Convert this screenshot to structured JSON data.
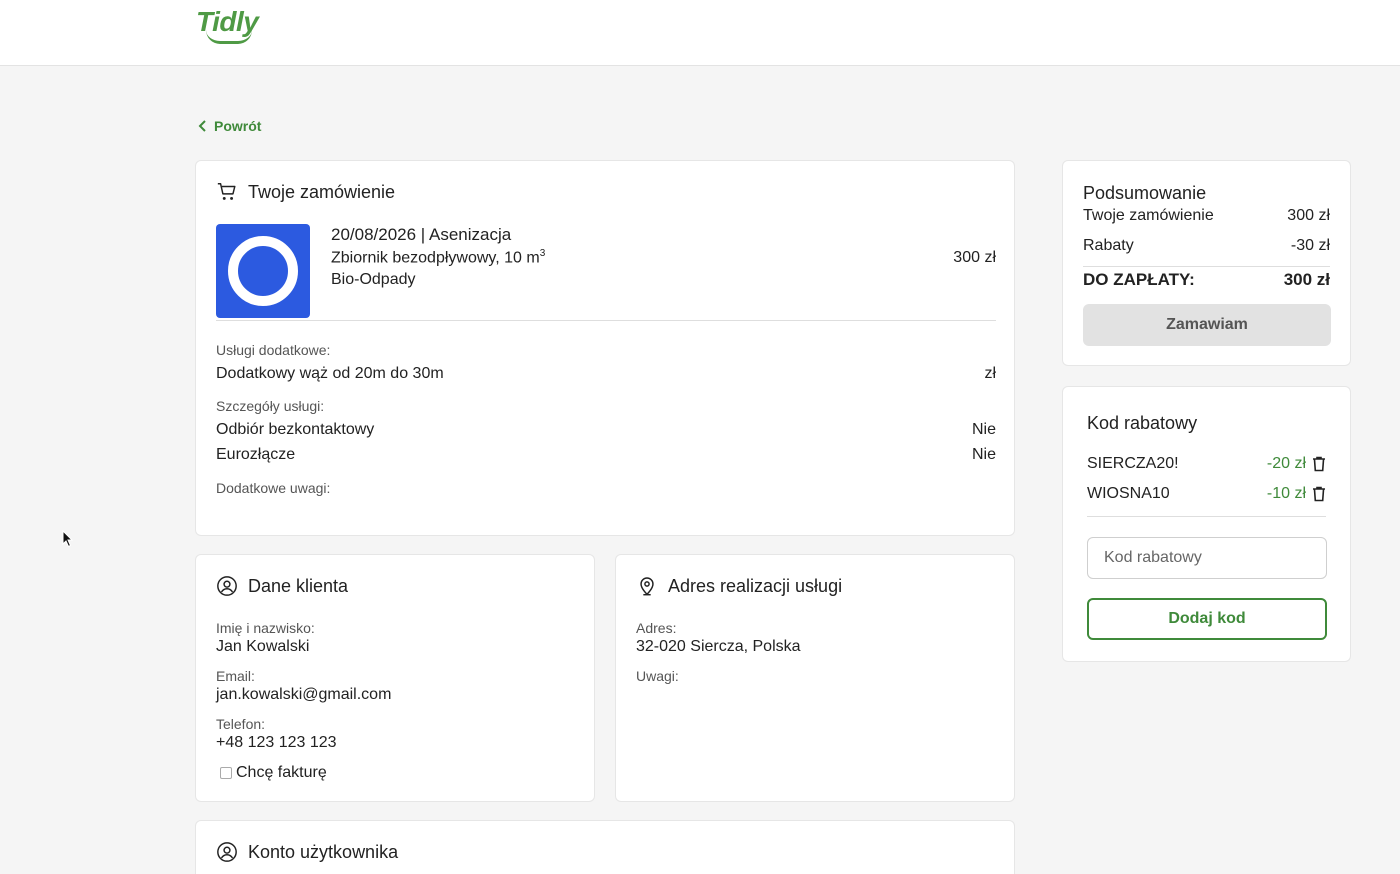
{
  "header": {
    "logo": "Tidly"
  },
  "nav": {
    "back_label": "Powrót"
  },
  "order": {
    "title": "Twoje zamówienie",
    "item": {
      "date_service": "20/08/2026 | Asenizacja",
      "tank": "Zbiornik bezodpływowy, 10 m",
      "tank_sup": "3",
      "category": "Bio-Odpady",
      "price": "300 zł"
    },
    "extra_services_label": "Usługi dodatkowe:",
    "extra_services": [
      {
        "name": "Dodatkowy wąż od 20m do 30m",
        "price": "zł"
      }
    ],
    "details_label": "Szczegóły usługi:",
    "details": [
      {
        "name": "Odbiór bezkontaktowy",
        "value": "Nie"
      },
      {
        "name": "Eurozłącze",
        "value": "Nie"
      }
    ],
    "notes_label": "Dodatkowe uwagi:"
  },
  "client": {
    "title": "Dane klienta",
    "name_label": "Imię i nazwisko:",
    "name": "Jan Kowalski",
    "email_label": "Email:",
    "email": "jan.kowalski@gmail.com",
    "phone_label": "Telefon:",
    "phone": "+48 123 123 123",
    "invoice_label": "Chcę fakturę"
  },
  "address": {
    "title": "Adres realizacji usługi",
    "address_label": "Adres:",
    "address": "32-020 Siercza, Polska",
    "notes_label": "Uwagi:"
  },
  "account": {
    "title": "Konto użytkownika"
  },
  "summary": {
    "title": "Podsumowanie",
    "order_label": "Twoje zamówienie",
    "order_value": "300 zł",
    "discount_label": "Rabaty",
    "discount_value": "-30 zł",
    "total_label": "DO ZAPŁATY:",
    "total_value": "300 zł",
    "submit_label": "Zamawiam"
  },
  "discount": {
    "title": "Kod rabatowy",
    "codes": [
      {
        "code": "SIERCZA20!",
        "value": "-20 zł"
      },
      {
        "code": "WIOSNA10",
        "value": "-10 zł"
      }
    ],
    "input_placeholder": "Kod rabatowy",
    "add_label": "Dodaj kod"
  },
  "colors": {
    "brand": "#4f9a45",
    "accent_blue": "#2c5ae0"
  }
}
